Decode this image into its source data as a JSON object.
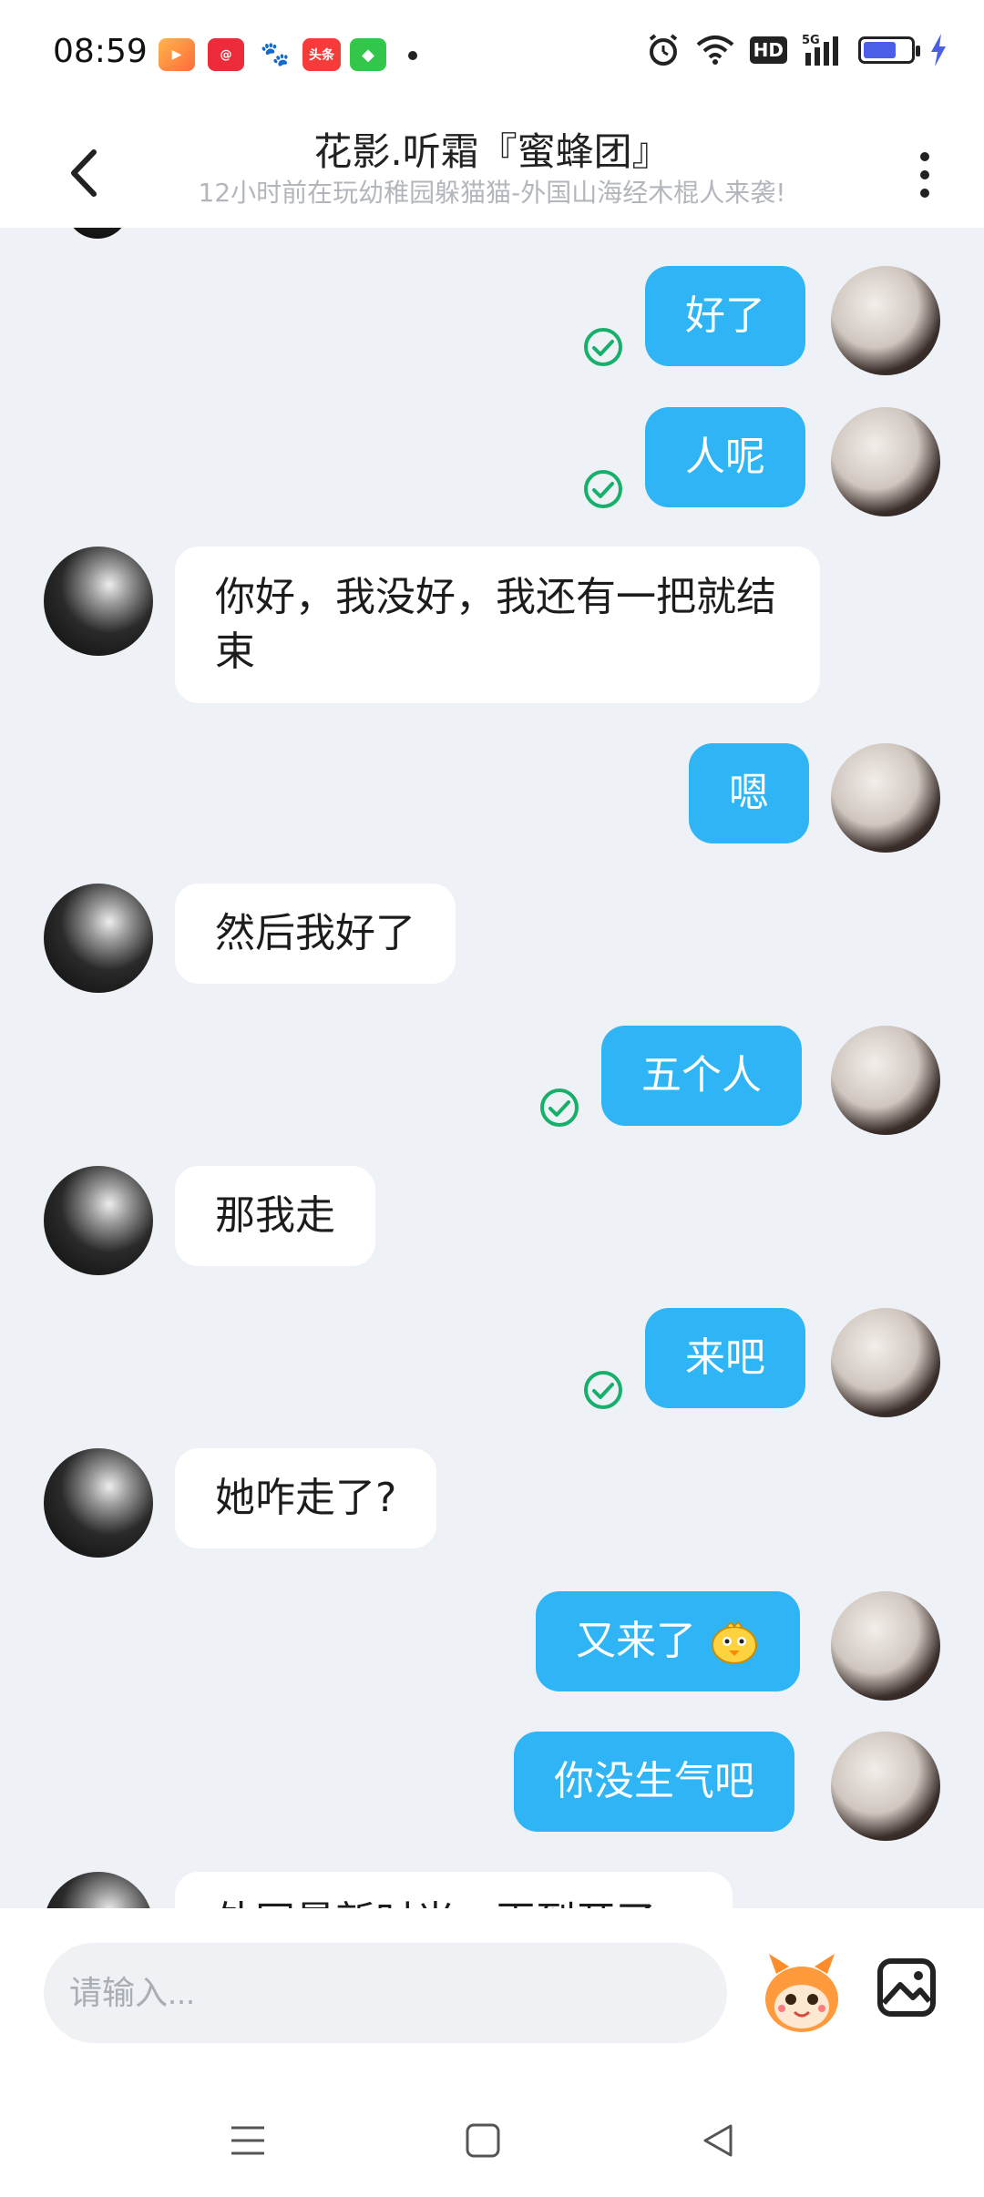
{
  "status_bar": {
    "time": "08:59",
    "app_icons": [
      {
        "name": "video-app-icon",
        "glyph": "▶"
      },
      {
        "name": "shopping-app-icon",
        "glyph": "@"
      },
      {
        "name": "baidu-paw-icon",
        "glyph": "🐾"
      },
      {
        "name": "news-app-icon",
        "glyph": "头条"
      },
      {
        "name": "green-app-icon",
        "glyph": "◆"
      }
    ],
    "hd_label": "HD",
    "signal_label": "5G",
    "battery_level": 0.7,
    "battery_color": "#4b5ee8"
  },
  "header": {
    "title": "花影.听霜『蜜蜂团』",
    "subtitle": "12小时前在玩幼稚园躲猫猫-外国山海经木棍人来袭!"
  },
  "messages": [
    {
      "sender": "me",
      "text": "好了",
      "read": true
    },
    {
      "sender": "me",
      "text": "人呢",
      "read": true
    },
    {
      "sender": "other",
      "text": "你好，我没好，我还有一把就结束"
    },
    {
      "sender": "me",
      "text": "嗯",
      "read": false
    },
    {
      "sender": "other",
      "text": "然后我好了"
    },
    {
      "sender": "me",
      "text": "五个人",
      "read": true
    },
    {
      "sender": "other",
      "text": "那我走"
    },
    {
      "sender": "me",
      "text": "来吧",
      "read": true
    },
    {
      "sender": "other",
      "text": "她咋走了?"
    },
    {
      "sender": "me",
      "text": "又来了",
      "emoji": "emoji-chick-icon",
      "read": false
    },
    {
      "sender": "me",
      "text": "你没生气吧",
      "read": false
    },
    {
      "sender": "other",
      "text": "外网最新时光，再到开了"
    }
  ],
  "input": {
    "placeholder": "请输入..."
  },
  "colors": {
    "my_bubble": "#2fb5f5",
    "other_bubble": "#ffffff",
    "read_check": "#17b06b",
    "chat_bg": "#eef1f6"
  }
}
